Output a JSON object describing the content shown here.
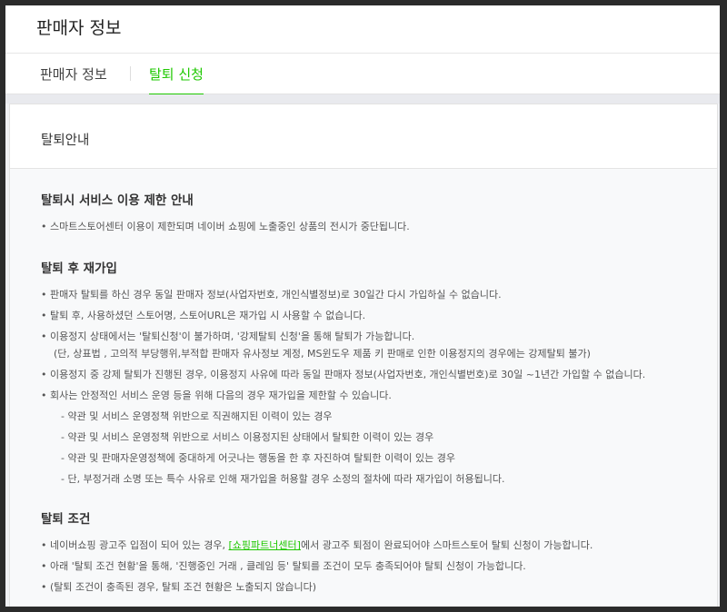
{
  "header": {
    "title": "판매자 정보"
  },
  "tabs": [
    {
      "label": "판매자 정보",
      "active": false
    },
    {
      "label": "탈퇴 신청",
      "active": true
    }
  ],
  "colors": {
    "accent": "#1ec800"
  },
  "card": {
    "title": "탈퇴안내"
  },
  "sections": {
    "restriction": {
      "title": "탈퇴시 서비스 이용 제한 안내",
      "items": [
        "스마트스토어센터 이용이 제한되며 네이버 쇼핑에 노출중인 상품의 전시가 중단됩니다."
      ]
    },
    "rejoin": {
      "title": "탈퇴 후 재가입",
      "items": [
        "판매자 탈퇴를 하신 경우 동일 판매자 정보(사업자번호, 개인식별정보)로 30일간 다시 가입하실 수 없습니다.",
        "탈퇴 후, 사용하셨던 스토어명, 스토어URL은 재가입 시 사용할 수 없습니다.",
        "이용정지 상태에서는 '탈퇴신청'이 불가하며, '강제탈퇴 신청'을 통해 탈퇴가 가능합니다.",
        "(단, 상표법 , 고의적 부당행위,부적합 판매자 유사정보 계정, MS윈도우 제품 키 판매로 인한 이용정지의 경우에는 강제탈퇴 불가)",
        "이용정지 중 강제 탈퇴가 진행된 경우, 이용정지 사유에 따라 동일 판매자 정보(사업자번호, 개인식별번호)로 30일 ~1년간 가입할 수 없습니다.",
        "회사는 안정적인 서비스 운영 등을 위해 다음의 경우 재가입을 제한할 수 있습니다."
      ],
      "sub_items": [
        "- 약관 및 서비스 운영정책 위반으로 직권해지된 이력이 있는 경우",
        "- 약관 및 서비스 운영정책 위반으로 서비스 이용정지된 상태에서 탈퇴한 이력이 있는 경우",
        "- 약관 및 판매자운영정책에 중대하게 어긋나는 행동을 한 후 자진하여 탈퇴한 이력이 있는 경우",
        "- 단, 부정거래 소명 또는 특수 사유로 인해 재가입을 허용할 경우 소정의 절차에 따라 재가입이 허용됩니다."
      ]
    },
    "conditions": {
      "title": "탈퇴 조건",
      "item1_before": "네이버쇼핑 광고주 입점이 되어 있는 경우, ",
      "item1_link": "[쇼핑파트너센터]",
      "item1_after": "에서 광고주 퇴점이 완료되어야 스마트스토어 탈퇴 신청이 가능합니다.",
      "items": [
        "아래 '탈퇴 조건 현황'을 통해, '진행중인 거래 , 클레임 등' 탈퇴를 조건이 모두 충족되어야 탈퇴 신청이 가능합니다.",
        "(탈퇴 조건이 충족된 경우, 탈퇴 조건 현황은 노출되지 않습니다)"
      ]
    }
  }
}
